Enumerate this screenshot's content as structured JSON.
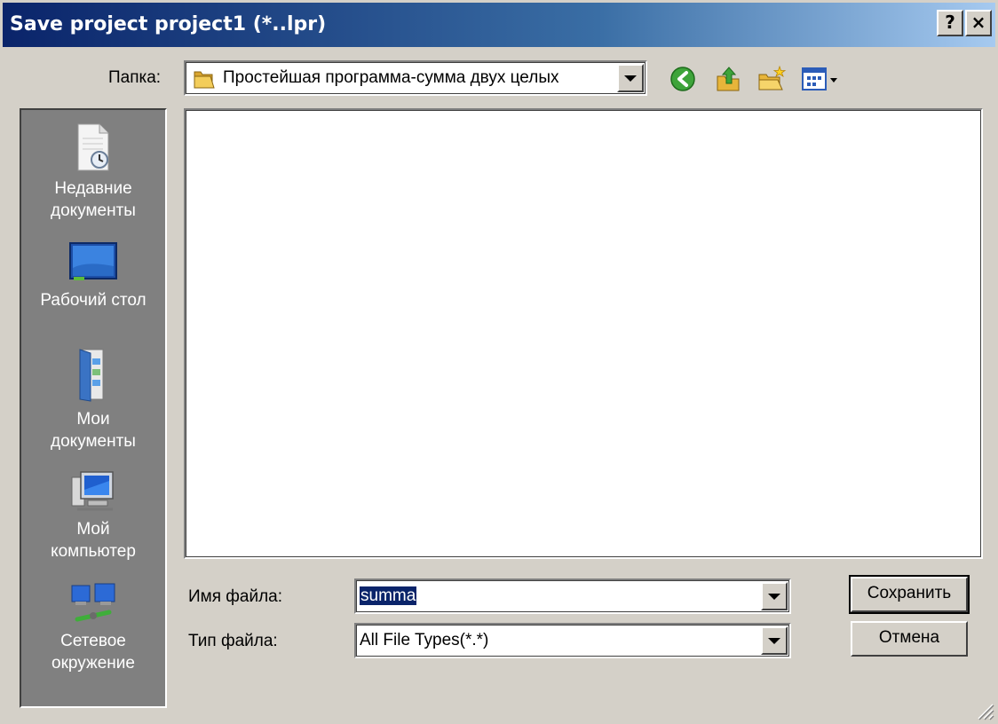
{
  "window": {
    "title": "Save project project1 (*..lpr)",
    "help_label": "?",
    "close_label": "×"
  },
  "toolbar": {
    "folder_label": "Папка:",
    "folder_value": "Простейшая программа-сумма двух целых"
  },
  "places": [
    {
      "line1": "Недавние",
      "line2": "документы",
      "icon": "recent-documents-icon"
    },
    {
      "line1": "Рабочий стол",
      "line2": "",
      "icon": "desktop-icon"
    },
    {
      "line1": "Мои",
      "line2": "документы",
      "icon": "my-documents-icon"
    },
    {
      "line1": "Мой",
      "line2": "компьютер",
      "icon": "my-computer-icon"
    },
    {
      "line1": "Сетевое",
      "line2": "окружение",
      "icon": "network-icon"
    }
  ],
  "form": {
    "filename_label": "Имя файла:",
    "filename_value": "summa",
    "filetype_label": "Тип файла:",
    "filetype_value": "All File Types(*.*)"
  },
  "buttons": {
    "save": "Сохранить",
    "cancel": "Отмена"
  },
  "colors": {
    "title_start": "#0a246a",
    "title_end": "#a6caf0",
    "face": "#d4d0c8",
    "places_bg": "#808080",
    "selection": "#0a246a"
  }
}
